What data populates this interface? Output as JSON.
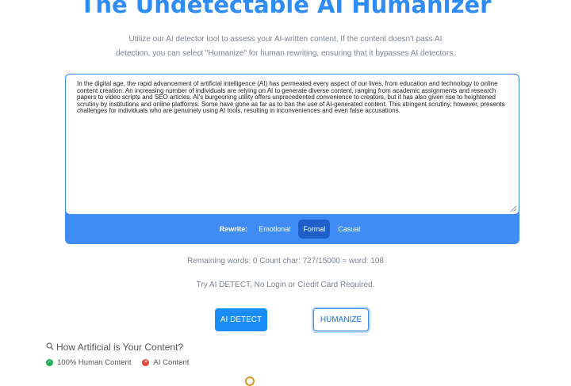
{
  "header": {
    "title": "The Undetectable AI Humanizer",
    "subtitle": "Utilize our AI detector tool to assess your AI-written content, If the content doesn't pass AI detection, you can select \"Humanize\" for human rewriting, ensuring that it bypasses AI detectors."
  },
  "editor": {
    "text": "In the digital age, the rapid advancement of artificial intelligence (AI) has permeated every aspect of our lives, from education and technology to online content creation. An increasing number of individuals are relying on AI to generate diverse content, ranging from academic assignments and research papers to video scripts and SEO articles. AI's burgeoning utility offers unprecedented convenience to creators, but it has also given rise to heightened scrutiny by institutions and online platforms. Some have gone as far as to ban the use of AI-generated content. This stringent scrutiny, however, presents challenges for individuals who are genuinely using AI tools, resulting in inconveniences and even false accusations."
  },
  "rewrite": {
    "label": "Rewrite:",
    "modes": [
      "Emotional",
      "Formal",
      "Casual"
    ],
    "selected": "Formal"
  },
  "stats": {
    "text": "Remaining words: 0   Count char: 727/15000 ≈ word: 108"
  },
  "promo": {
    "text": "Try AI DETECT, No Login or Credit Card Required."
  },
  "buttons": {
    "detect": "AI DETECT",
    "humanize": "HUMANIZE"
  },
  "results": {
    "heading": "How Artificial is Your Content?",
    "legend_human": "100% Human Content",
    "legend_ai": "AI Content"
  },
  "colors": {
    "accent": "#2f8cf4",
    "human": "#1fae55",
    "ai": "#e0463b"
  }
}
